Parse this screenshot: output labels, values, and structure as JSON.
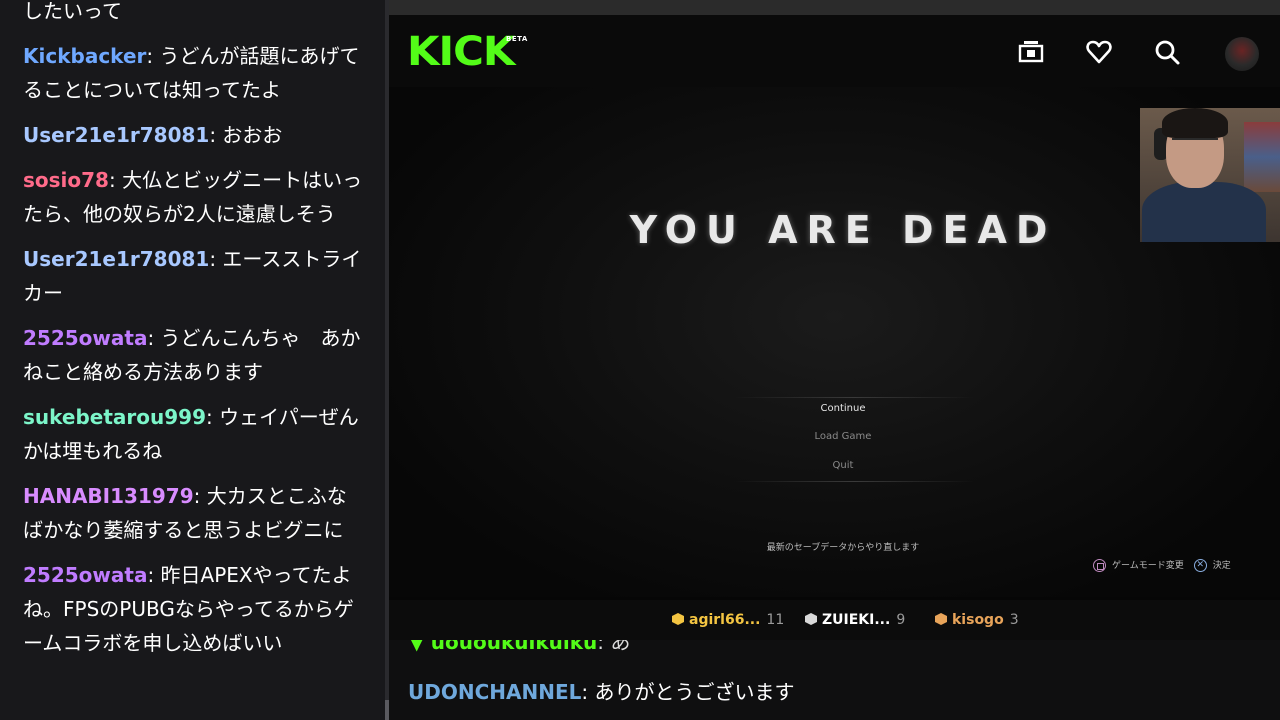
{
  "left_chat": [
    {
      "user": "",
      "color": "#ffffff",
      "text": "したいって"
    },
    {
      "user": "Kickbacker",
      "color": "#6fa8ff",
      "text": ": うどんが話題にあげてることについては知ってたよ"
    },
    {
      "user": "User21e1r78081",
      "color": "#a8c8ff",
      "text": ": おおお"
    },
    {
      "user": "sosio78",
      "color": "#ff6b8a",
      "text": ": 大仏とビッグニートはいったら、他の奴らが2人に遠慮しそう"
    },
    {
      "user": "User21e1r78081",
      "color": "#a8c8ff",
      "text": ": エースストライカー"
    },
    {
      "user": "2525owata",
      "color": "#c07cff",
      "text": ": うどんこんちゃ　あかねこと絡める方法あります"
    },
    {
      "user": "sukebetarou999",
      "color": "#7cf5c9",
      "text": ": ウェイパーぜんかは埋もれるね"
    },
    {
      "user": "HANABI131979",
      "color": "#d88cff",
      "text": ": 大カスとこふなばかなり萎縮すると思うよビグニに"
    },
    {
      "user": "2525owata",
      "color": "#c07cff",
      "text": ": 昨日APEXやってたよね。FPSのPUBGならやってるからゲームコラボを申し込めばいい"
    }
  ],
  "kick": {
    "logo": "KICK",
    "beta": "BETA",
    "icons": [
      "theater-mode-icon",
      "heart-icon",
      "search-icon",
      "avatar"
    ]
  },
  "game": {
    "title": "YOU ARE DEAD",
    "menu": [
      {
        "label": "Continue",
        "selected": true
      },
      {
        "label": "Load Game",
        "selected": false
      },
      {
        "label": "Quit",
        "selected": false
      }
    ],
    "hint": "最新のセーブデータからやり直します",
    "controls": {
      "mode": "ゲームモード変更",
      "confirm": "決定"
    }
  },
  "leaderboard": [
    {
      "name": "agirl66...",
      "count": "11",
      "color": "#f4c542"
    },
    {
      "name": "ZUIEKI...",
      "count": "9",
      "color": "#d9d9d9"
    },
    {
      "name": "kisogo",
      "count": "3",
      "color": "#e8a45a"
    }
  ],
  "bottom_chat": {
    "cut_user": "uououkuikuiku",
    "cut_text": ": あ",
    "user": "UDONCHANNEL",
    "text": ": ありがとうございます"
  },
  "colors": {
    "kick_green": "#53fc18"
  }
}
